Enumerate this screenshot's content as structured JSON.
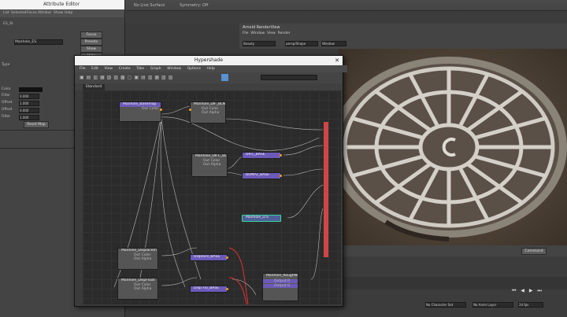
{
  "topbar": {
    "items": [
      "No Live Surface",
      "Symmetry: Off"
    ]
  },
  "attribute_editor": {
    "title": "Attribute Editor",
    "menus": [
      "List",
      "Selected",
      "Focus",
      "Attribut",
      "Show",
      "Help"
    ],
    "node_tab": "ES_St",
    "name_label": "Manhole_ES",
    "focus_button": "Focus",
    "presets_button": "Presets",
    "show_button": "Show",
    "hide_button": "Hide",
    "field_labels": [
      "Type",
      "Color",
      "Filter",
      "Offset",
      "Offset",
      "Filter"
    ],
    "field_values": [
      "0.000",
      "1.000",
      "0.000",
      "1.000"
    ],
    "button_label": "Reset Map"
  },
  "hypershade": {
    "title": "Hypershade",
    "menus": [
      "File",
      "Edit",
      "View",
      "Create",
      "Tabs",
      "Graph",
      "Window",
      "Options",
      "Help"
    ],
    "tab": "Standard",
    "nodes": [
      {
        "label": "Manhole_Basemap",
        "port1": "Out Color",
        "port2": "Out Alpha"
      },
      {
        "label": "Manhole_DIF_BLN",
        "port1": "Out Color",
        "port2": "Out Alpha"
      },
      {
        "label": "Manhole_DIFC_BLN",
        "port1": "Out Color",
        "port2": "Out Alpha"
      },
      {
        "label": "DIFC_BASE",
        "port1": "",
        "port2": ""
      },
      {
        "label": "BUMP2_BASE",
        "port1": "",
        "port2": ""
      },
      {
        "label": "Manhole_LTS",
        "port1": "",
        "port2": ""
      },
      {
        "label": "Manhole_Displacem",
        "port1": "Out Color",
        "port2": "Out Alpha"
      },
      {
        "label": "Displace_BASE",
        "port1": "",
        "port2": ""
      },
      {
        "label": "Manhole_DispFloat",
        "port1": "Out Color",
        "port2": "Out Alpha"
      },
      {
        "label": "Disp Flo_BASE",
        "port1": "",
        "port2": ""
      },
      {
        "label": "Manhole_RoughNess",
        "port1": "Output R",
        "port2": "Output G"
      }
    ]
  },
  "viewport_panel": {
    "title": "Arnold RenderView",
    "menus": [
      "File",
      "Window",
      "View",
      "Render"
    ],
    "dropdown1": "Beauty",
    "dropdown2": "persp/Shape",
    "dropdown3": "Window"
  },
  "timeline": {
    "command_label": "Command",
    "char_set": "No Character Set",
    "anim_layer": "No Anim Layer",
    "fps": "24 fps"
  },
  "colors": {
    "node_purple": "#6c5ab8",
    "port_orange": "#f4a020",
    "selected_border": "#32d7a4"
  }
}
